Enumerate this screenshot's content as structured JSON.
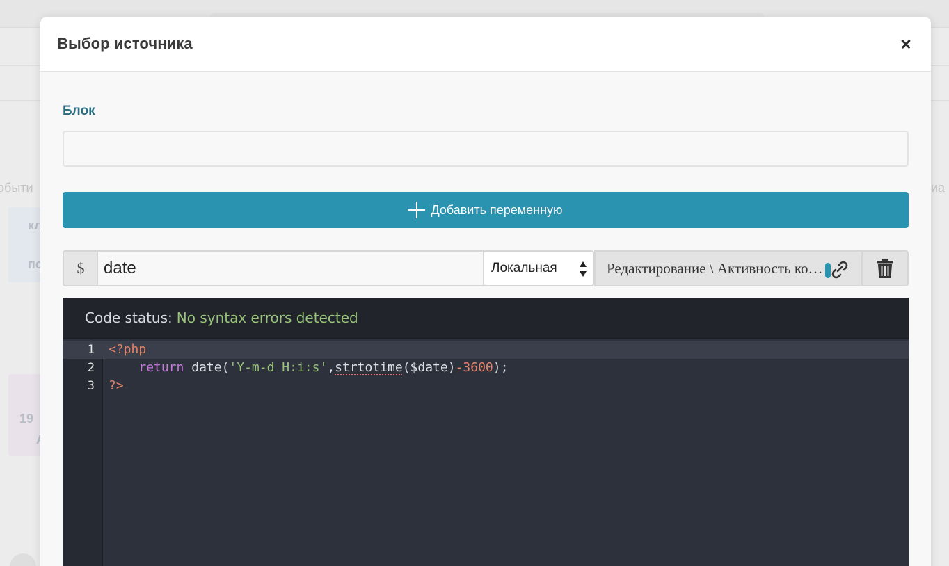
{
  "background": {
    "text_left": "обыти",
    "text_right": "иа",
    "card1_line1": "кл",
    "card1_line2": "пс",
    "card2_line1": "19",
    "card2_line2": "А"
  },
  "modal": {
    "title": "Выбор источника"
  },
  "block": {
    "label": "Блок",
    "value": ""
  },
  "add_variable_label": "Добавить переменную",
  "variable": {
    "prefix": "$",
    "name": "date",
    "scope": "Локальная",
    "scope_options": [
      "Локальная"
    ],
    "source": "Редактирование \\ Активность контакта"
  },
  "editor": {
    "status_label": "Code status:",
    "status_value": "No syntax errors detected",
    "line_numbers": [
      "1",
      "2",
      "3"
    ],
    "lines": [
      "<?php",
      "    return date('Y-m-d H:i:s',strtotime($date)-3600);",
      "?>"
    ]
  },
  "colors": {
    "accent": "#2a93b0",
    "label": "#2a6f84",
    "editor_bg": "#2c313c",
    "status_ok": "#98c379"
  }
}
